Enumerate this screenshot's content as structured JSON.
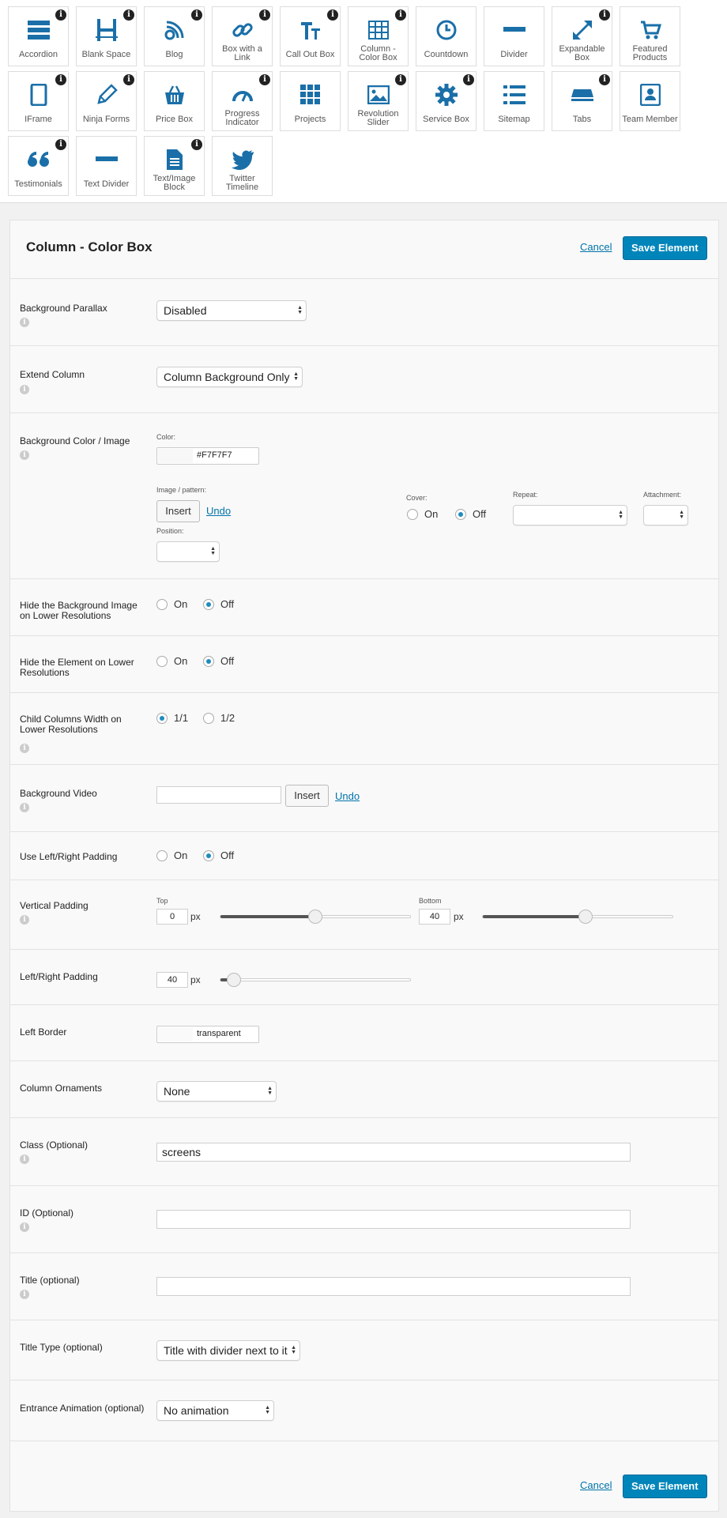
{
  "elements": [
    {
      "label": "Accordion",
      "icon": "accordion-icon",
      "info": true
    },
    {
      "label": "Blank Space",
      "icon": "blank-space-icon",
      "info": true
    },
    {
      "label": "Blog",
      "icon": "blog-icon",
      "info": true
    },
    {
      "label": "Box with a Link",
      "icon": "link-icon",
      "info": true
    },
    {
      "label": "Call Out Box",
      "icon": "callout-text-icon",
      "info": true
    },
    {
      "label": "Column - Color Box",
      "icon": "table-grid-icon",
      "info": true
    },
    {
      "label": "Countdown",
      "icon": "clock-icon",
      "info": false
    },
    {
      "label": "Divider",
      "icon": "divider-icon",
      "info": false
    },
    {
      "label": "Expandable Box",
      "icon": "expand-arrows-icon",
      "info": true
    },
    {
      "label": "Featured Products",
      "icon": "cart-icon",
      "info": false
    },
    {
      "label": "IFrame",
      "icon": "tablet-icon",
      "info": true
    },
    {
      "label": "Ninja Forms",
      "icon": "pencil-icon",
      "info": true
    },
    {
      "label": "Price Box",
      "icon": "basket-icon",
      "info": false
    },
    {
      "label": "Progress Indicator",
      "icon": "gauge-icon",
      "info": true
    },
    {
      "label": "Projects",
      "icon": "grid-squares-icon",
      "info": false
    },
    {
      "label": "Revolution Slider",
      "icon": "image-icon",
      "info": true
    },
    {
      "label": "Service Box",
      "icon": "gear-icon",
      "info": true
    },
    {
      "label": "Sitemap",
      "icon": "list-icon",
      "info": false
    },
    {
      "label": "Tabs",
      "icon": "tabs-icon",
      "info": true
    },
    {
      "label": "Team Member",
      "icon": "contact-card-icon",
      "info": false
    },
    {
      "label": "Testimonials",
      "icon": "quote-icon",
      "info": true
    },
    {
      "label": "Text Divider",
      "icon": "text-divider-icon",
      "info": false
    },
    {
      "label": "Text/Image Block",
      "icon": "document-icon",
      "info": true
    },
    {
      "label": "Twitter Timeline",
      "icon": "twitter-icon",
      "info": false
    }
  ],
  "editor": {
    "title": "Column - Color Box",
    "cancel_label": "Cancel",
    "save_label": "Save Element",
    "accent_color": "#0085ba"
  },
  "fields": {
    "background_parallax": {
      "label": "Background Parallax",
      "value": "Disabled"
    },
    "extend_column": {
      "label": "Extend Column",
      "value": "Column Background Only"
    },
    "background_color_image": {
      "label": "Background Color / Image",
      "color_label": "Color:",
      "color_value": "#F7F7F7",
      "image_label": "Image / pattern:",
      "insert_label": "Insert",
      "undo_label": "Undo",
      "position_label": "Position:",
      "position_value": "",
      "cover_label": "Cover:",
      "cover_on": "On",
      "cover_off": "Off",
      "cover_selected": "Off",
      "repeat_label": "Repeat:",
      "repeat_value": "",
      "attachment_label": "Attachment:",
      "attachment_value": ""
    },
    "hide_bg_lower": {
      "label": "Hide the Background Image on Lower Resolutions",
      "on": "On",
      "off": "Off",
      "selected": "Off"
    },
    "hide_element_lower": {
      "label": "Hide the Element on Lower Resolutions",
      "on": "On",
      "off": "Off",
      "selected": "Off"
    },
    "child_columns_width": {
      "label": "Child Columns Width on Lower Resolutions",
      "opt1": "1/1",
      "opt2": "1/2",
      "selected": "1/1"
    },
    "background_video": {
      "label": "Background Video",
      "value": "",
      "insert_label": "Insert",
      "undo_label": "Undo"
    },
    "use_lr_padding": {
      "label": "Use Left/Right Padding",
      "on": "On",
      "off": "Off",
      "selected": "Off"
    },
    "vertical_padding": {
      "label": "Vertical Padding",
      "top_label": "Top",
      "top_value": "0",
      "bottom_label": "Bottom",
      "bottom_value": "40",
      "unit": "px",
      "top_slider_fraction": 0.5,
      "bottom_slider_fraction": 0.54
    },
    "lr_padding": {
      "label": "Left/Right Padding",
      "value": "40",
      "unit": "px",
      "slider_fraction": 0.07
    },
    "left_border": {
      "label": "Left Border",
      "value": "transparent"
    },
    "column_ornaments": {
      "label": "Column Ornaments",
      "value": "None"
    },
    "class_optional": {
      "label": "Class (Optional)",
      "value": "screens"
    },
    "id_optional": {
      "label": "ID (Optional)",
      "value": ""
    },
    "title_optional": {
      "label": "Title (optional)",
      "value": ""
    },
    "title_type": {
      "label": "Title Type (optional)",
      "value": "Title with divider next to it"
    },
    "entrance_animation": {
      "label": "Entrance Animation (optional)",
      "value": "No animation"
    }
  }
}
